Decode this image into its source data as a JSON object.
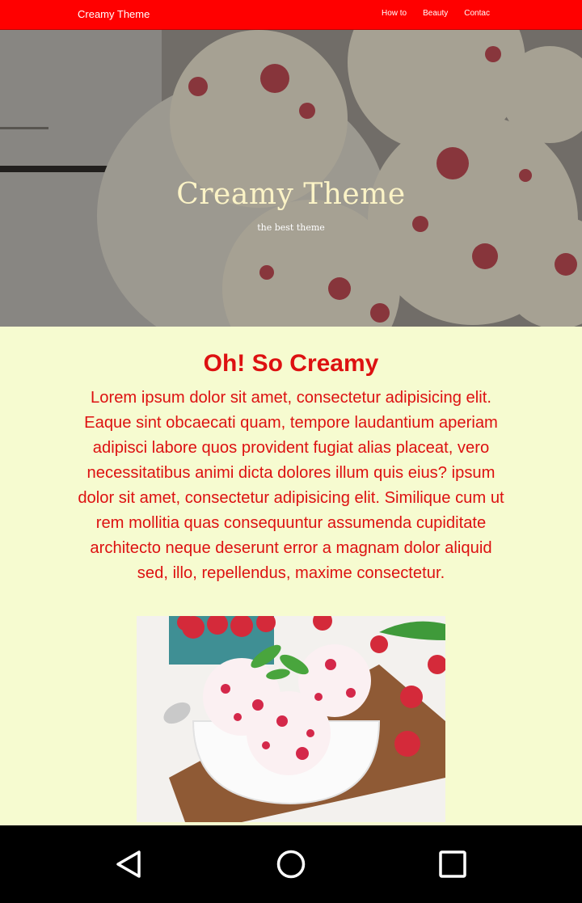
{
  "navbar": {
    "brand": "Creamy Theme",
    "links": [
      "How to",
      "Beauty",
      "Contac"
    ],
    "color": "#ff0000"
  },
  "hero": {
    "title": "Creamy Theme",
    "subtitle": "the best theme"
  },
  "main": {
    "heading": "Oh! So Creamy",
    "paragraph": "Lorem ipsum dolor sit amet, consectetur adipisicing elit. Eaque sint obcaecati quam, tempore laudantium aperiam adipisci labore quos provident fugiat alias placeat, vero necessitatibus animi dicta dolores illum quis eius? ipsum dolor sit amet, consectetur adipisicing elit. Similique cum ut rem mollitia quas consequuntur assumenda cupiditate architecto neque deserunt error a magnam dolor aliquid sed, illo, repellendus, maxime consectetur.",
    "text_color": "#dd1111",
    "background": "#f6fbd0"
  },
  "icons": {
    "back": "back-triangle-icon",
    "home": "home-circle-icon",
    "recents": "recents-square-icon"
  }
}
